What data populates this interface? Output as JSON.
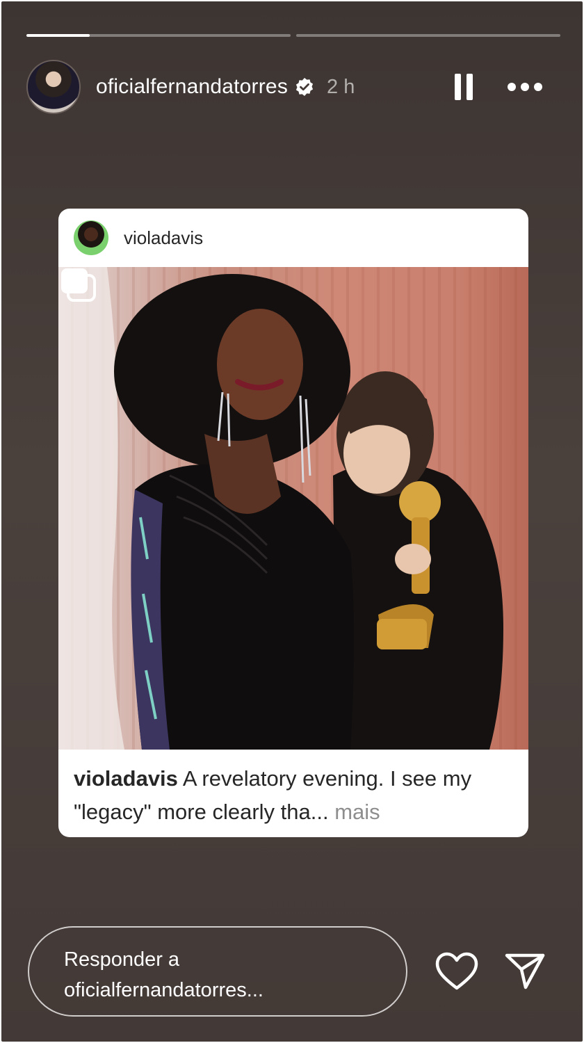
{
  "story": {
    "progress": [
      0.24,
      0.0
    ],
    "username": "oficialfernandatorres",
    "time": "2 h",
    "icons": {
      "avatar": "profile-avatar",
      "verified": "verified-badge-icon",
      "pause": "pause-icon",
      "more": "more-options-icon"
    }
  },
  "post": {
    "username": "violadavis",
    "caption_user": "violadavis",
    "caption_text": "A revelatory evening. I see my \"legacy\" more clearly tha...",
    "more_label": "mais",
    "icons": {
      "carousel": "multiple-images-icon"
    }
  },
  "reply": {
    "placeholder_line1": "Responder a",
    "placeholder_line2": "oficialfernandatorres...",
    "icons": {
      "like": "heart-icon",
      "share": "send-icon"
    }
  },
  "colors": {
    "background": "#433936",
    "card": "#ffffff",
    "secondary_text": "#8e8e8e"
  }
}
